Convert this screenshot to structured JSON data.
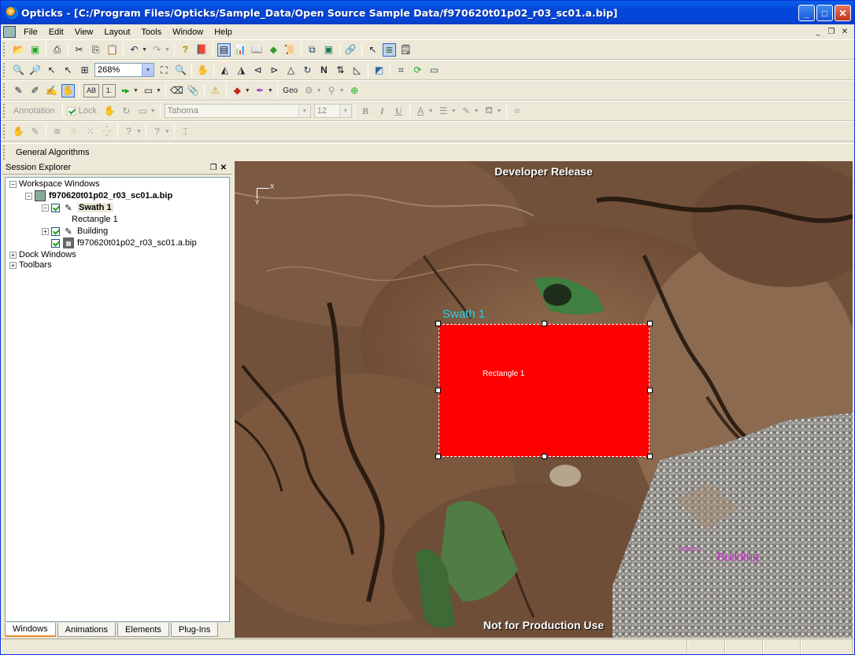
{
  "window": {
    "title": "Opticks - [C:/Program Files/Opticks/Sample_Data/Open Source Sample Data/f970620t01p02_r03_sc01.a.bip]"
  },
  "menu": [
    "File",
    "Edit",
    "View",
    "Layout",
    "Tools",
    "Window",
    "Help"
  ],
  "toolbar": {
    "zoom_value": "268%",
    "geo_label": "Geo",
    "text_ab": "AB",
    "text_one": "1.",
    "annotation_label": "Annotation",
    "lock_label": "Lock",
    "font_name": "Tahoma",
    "font_size": "12",
    "bold": "B",
    "italic": "I",
    "underline": "U",
    "help_q": "?",
    "n_up": "N",
    "general_algorithms": "General Algorithms"
  },
  "session_explorer": {
    "title": "Session Explorer",
    "tree": {
      "workspace_windows": "Workspace Windows",
      "file_node": "f970620t01p02_r03_sc01.a.bip",
      "swath": "Swath 1",
      "rectangle": "Rectangle 1",
      "building": "Building",
      "raster": "f970620t01p02_r03_sc01.a.bip",
      "dock_windows": "Dock Windows",
      "toolbars": "Toolbars"
    },
    "tabs": [
      "Windows",
      "Animations",
      "Elements",
      "Plug-Ins"
    ],
    "active_tab": "Windows"
  },
  "view": {
    "header_text": "Developer Release",
    "footer_text": "Not for Production Use",
    "axis_x": "X",
    "axis_y": "Y",
    "layer_swath_label": "Swath 1",
    "rectangle_label": "Rectangle 1",
    "layer_building_label": "Building",
    "point_label": "Point 1",
    "swath_color": "#22d3ee",
    "rectangle_fill": "#ff0000",
    "building_color": "#cc33cc"
  }
}
